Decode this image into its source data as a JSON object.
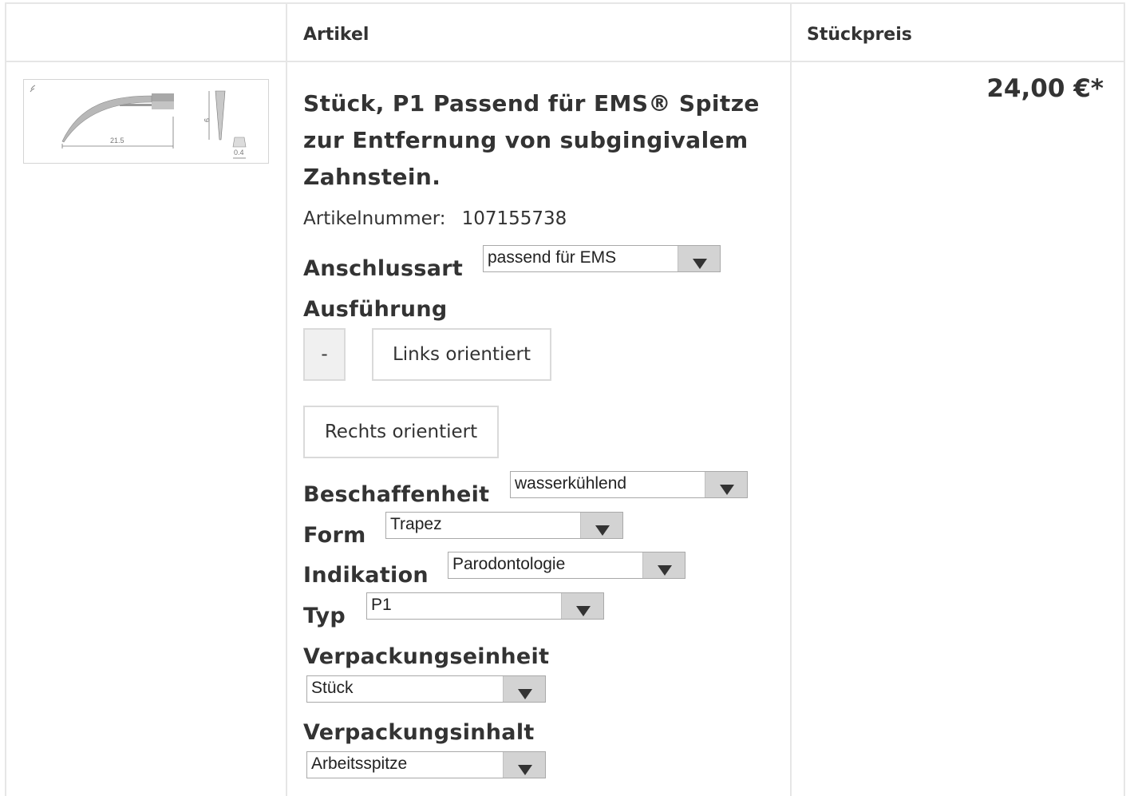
{
  "table": {
    "header_article": "Artikel",
    "header_price": "Stückpreis"
  },
  "product": {
    "title_line1": "Stück, P1 Passend für EMS® Spitze",
    "title_line2": "zur Entfernung von subgingivalem",
    "title_line3": "Zahnstein.",
    "article_number_label": "Artikelnummer:",
    "article_number": "107155738",
    "price": "24,00 €*",
    "image": {
      "dim_length": "21.5",
      "dim_height": "9",
      "dim_tip": "0.4"
    }
  },
  "options": {
    "anschlussart": {
      "label": "Anschlussart",
      "value": "passend für EMS"
    },
    "ausfuehrung": {
      "label": "Ausführung",
      "buttons": [
        "-",
        "Links orientiert",
        "Rechts orientiert"
      ]
    },
    "beschaffenheit": {
      "label": "Beschaffenheit",
      "value": "wasserkühlend"
    },
    "form": {
      "label": "Form",
      "value": "Trapez"
    },
    "indikation": {
      "label": "Indikation",
      "value": "Parodontologie"
    },
    "typ": {
      "label": "Typ",
      "value": "P1"
    },
    "verpackungseinheit": {
      "label": "Verpackungseinheit",
      "value": "Stück"
    },
    "verpackungsinhalt": {
      "label": "Verpackungsinhalt",
      "value": "Arbeitsspitze"
    }
  }
}
